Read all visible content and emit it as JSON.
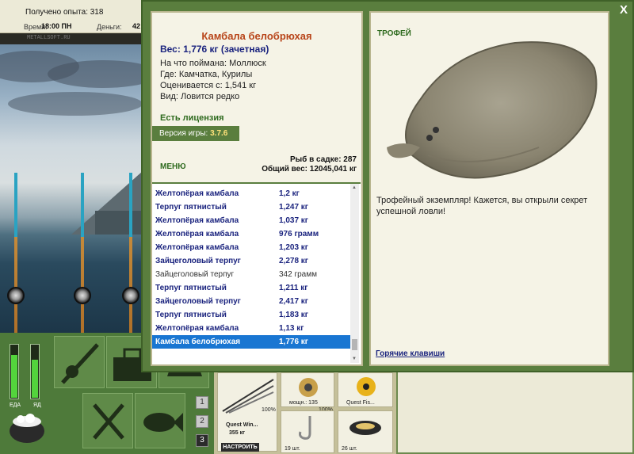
{
  "hud": {
    "exp_label": "Получено опыта: 318",
    "time_label": "Время:",
    "time_value": "18:00 ПН",
    "money_label": "Деньги:",
    "money_value": "42",
    "watermark": "METALLSOFT.RU"
  },
  "gauges": {
    "food_label": "ЕДА",
    "bait_label": "ЯД",
    "food_level": 0.8,
    "bait_level": 0.7
  },
  "pages": [
    "1",
    "2",
    "3"
  ],
  "active_page": "3",
  "equipment": {
    "rod_name": "Quest Win...",
    "rod_weight": "355 кг",
    "rod_percent": "100%",
    "reel_label": "мощн.: 135",
    "reel_percent": "100%",
    "line_name": "Quest Fis...",
    "hooks_count": "19 шт.",
    "bait_count": "26 шт.",
    "tune_button": "НАСТРОИТЬ"
  },
  "dialog": {
    "close_glyph": "X",
    "fish_title": "Камбала белобрюхая",
    "fish_weight": "Вес: 1,776 кг (зачетная)",
    "caught_on": "На что поймана: Моллюск",
    "location": "Где: Камчатка, Курилы",
    "valued": "Оценивается с: 1,541 кг",
    "kind": "Вид: Ловится редко",
    "license": "Есть лицензия",
    "version_label": "Версия игры:",
    "version_value": "3.7.6",
    "menu": "МЕНЮ",
    "fish_in_keepnet": "Рыб в садке: 287",
    "total_weight": "Общий вес: 12045,041 кг",
    "trophy_label": "ТРОФЕЙ",
    "trophy_text": "Трофейный экземпляр! Кажется, вы открыли секрет успешной ловли!",
    "hotkeys": "Горячие клавиши"
  },
  "catch_list": [
    {
      "name": "Желтопёрая камбала",
      "weight": "1,2 кг",
      "style": "b"
    },
    {
      "name": "Терпуг пятнистый",
      "weight": "1,247 кг",
      "style": "b"
    },
    {
      "name": "Желтопёрая камбала",
      "weight": "1,037 кг",
      "style": "b"
    },
    {
      "name": "Желтопёрая камбала",
      "weight": "976 грамм",
      "style": "b"
    },
    {
      "name": "Желтопёрая камбала",
      "weight": "1,203 кг",
      "style": "b"
    },
    {
      "name": "Зайцеголовый терпуг",
      "weight": "2,278 кг",
      "style": "b"
    },
    {
      "name": "Зайцеголовый терпуг",
      "weight": "342 грамм",
      "style": "p"
    },
    {
      "name": "Терпуг пятнистый",
      "weight": "1,211 кг",
      "style": "b"
    },
    {
      "name": "Зайцеголовый терпуг",
      "weight": "2,417 кг",
      "style": "b"
    },
    {
      "name": "Терпуг пятнистый",
      "weight": "1,183 кг",
      "style": "b"
    },
    {
      "name": "Желтопёрая камбала",
      "weight": "1,13 кг",
      "style": "b"
    },
    {
      "name": "Камбала белобрюхая",
      "weight": "1,776 кг",
      "style": "sel"
    }
  ],
  "colors": {
    "frame_green": "#5a7e3e",
    "title_orange": "#b8451a",
    "weight_navy": "#1a237e",
    "selection_blue": "#1976d2"
  }
}
